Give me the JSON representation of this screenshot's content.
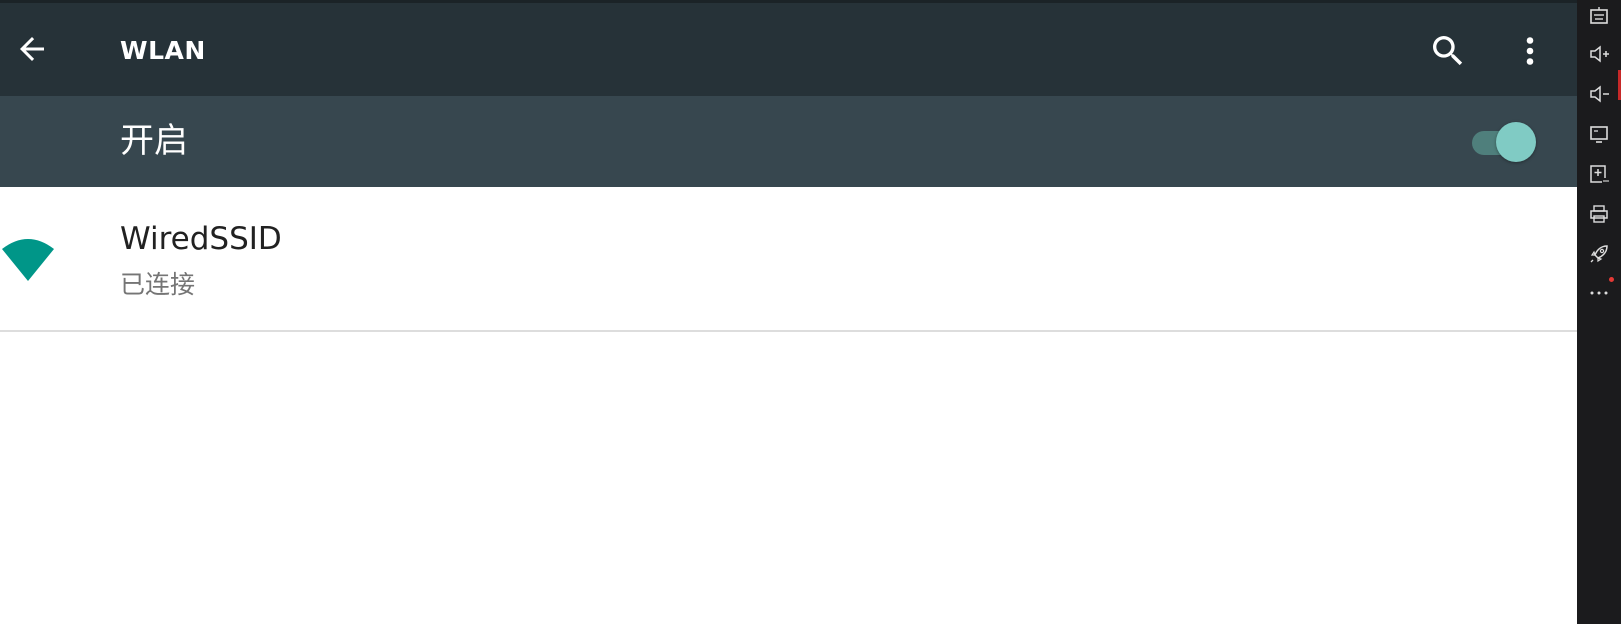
{
  "toolbar": {
    "back_icon": "arrow-back-icon",
    "title": "WLAN",
    "search_icon": "search-icon",
    "more_icon": "more-vert-icon",
    "background": "#263238"
  },
  "switch_bar": {
    "label": "开启",
    "toggle_state": "on",
    "background": "#37474f",
    "accent": "#80cbc4"
  },
  "networks": [
    {
      "ssid": "WiredSSID",
      "status": "已连接",
      "icon": "wifi-signal-icon",
      "icon_color": "#009688"
    }
  ],
  "side_panel": {
    "buttons": [
      "keyboard-icon",
      "volume-up-icon",
      "volume-down-icon",
      "screen-icon",
      "install-apk-icon",
      "printer-icon",
      "rocket-icon",
      "more-horiz-icon"
    ]
  }
}
